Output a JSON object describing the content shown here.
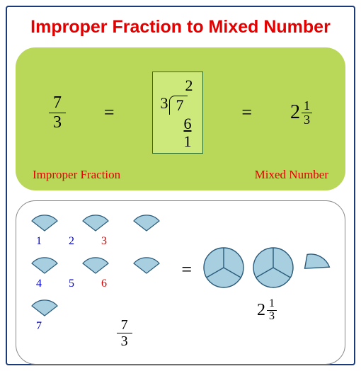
{
  "title": "Improper Fraction to Mixed Number",
  "panel1": {
    "fraction": {
      "num": "7",
      "den": "3"
    },
    "eq": "=",
    "division": {
      "quotient": "2",
      "divisor": "3",
      "dividend": "7",
      "sub": "6",
      "rem": "1"
    },
    "mixed": {
      "whole": "2",
      "num": "1",
      "den": "3"
    },
    "label_left": "Improper Fraction",
    "label_right": "Mixed Number"
  },
  "panel2": {
    "numbers_row1": [
      "1",
      "2",
      "3"
    ],
    "colors_row1": [
      "b",
      "b",
      "r"
    ],
    "numbers_row2": [
      "4",
      "5",
      "6"
    ],
    "colors_row2": [
      "b",
      "b",
      "r"
    ],
    "numbers_row3": [
      "7"
    ],
    "colors_row3": [
      "b"
    ],
    "fraction": {
      "num": "7",
      "den": "3"
    },
    "eq": "=",
    "mixed": {
      "whole": "2",
      "num": "1",
      "den": "3"
    }
  },
  "chart_data": {
    "type": "diagram",
    "concept": "Convert improper fraction 7/3 to mixed number 2 1/3",
    "improper_fraction": {
      "numerator": 7,
      "denominator": 3
    },
    "long_division": {
      "dividend": 7,
      "divisor": 3,
      "quotient": 2,
      "remainder": 1
    },
    "mixed_number": {
      "whole": 2,
      "numerator": 1,
      "denominator": 3
    },
    "visual_thirds_count": 7,
    "visual_whole_circles": 2,
    "visual_extra_thirds": 1
  }
}
